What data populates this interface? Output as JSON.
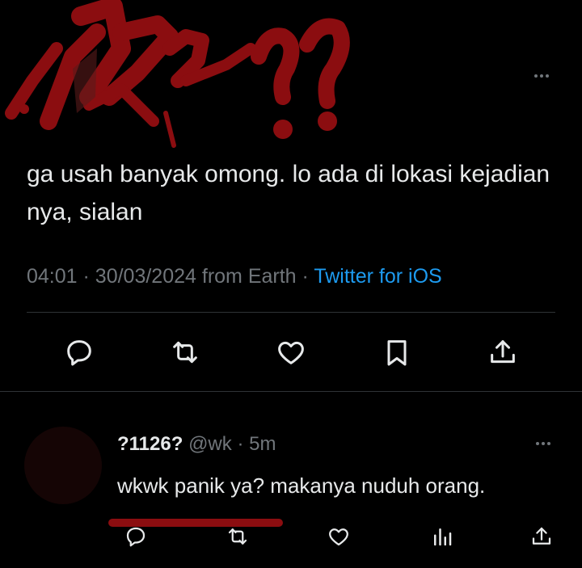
{
  "tweet": {
    "text": "ga usah banyak omong. lo ada di lokasi kejadian nya, sialan",
    "time": "04:01",
    "date": "30/03/2024",
    "location": "from Earth",
    "source": "Twitter for iOS",
    "separator": "·"
  },
  "actions": {
    "icons": [
      "reply-icon",
      "retweet-icon",
      "like-icon",
      "bookmark-icon",
      "share-icon"
    ]
  },
  "reply": {
    "name": "?1126?",
    "handle": "@wk",
    "separator": "·",
    "time": "5m",
    "text": "wkwk panik ya? makanya nuduh orang.",
    "icons": [
      "reply-icon",
      "retweet-icon",
      "like-icon",
      "views-icon",
      "share-icon"
    ]
  },
  "colors": {
    "background": "#000000",
    "text": "#e7e9ea",
    "muted": "#71767b",
    "link": "#1d9bf0",
    "divider": "#2f3336",
    "scribble": "#8b0d10"
  }
}
